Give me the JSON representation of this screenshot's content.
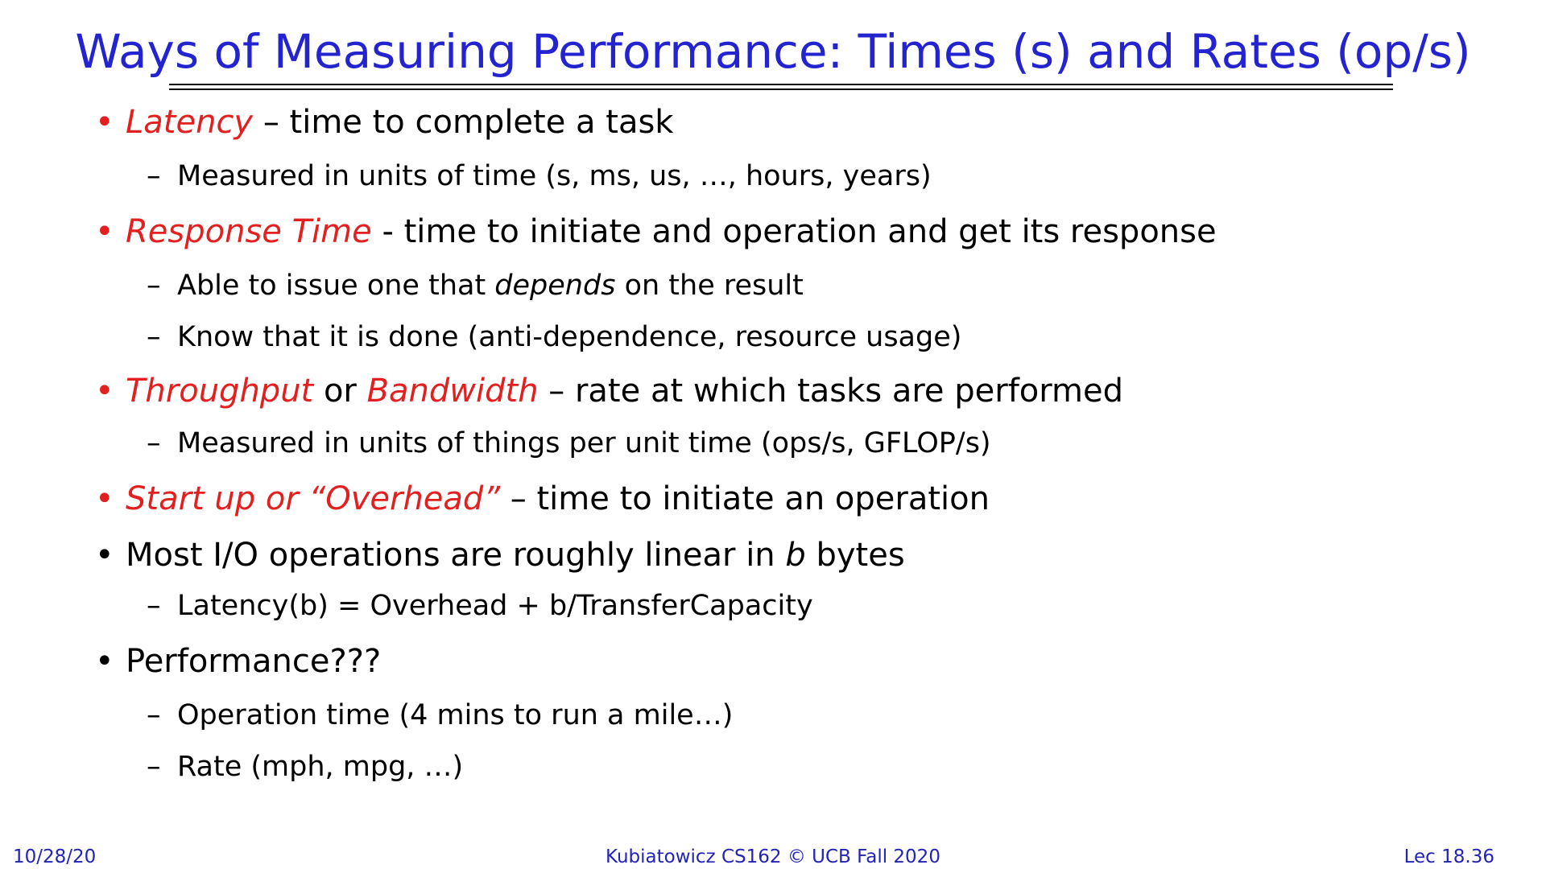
{
  "title": "Ways of Measuring Performance: Times (s) and Rates (op/s)",
  "bullets": [
    {
      "highlight": "Latency",
      "text": " – time to complete a task",
      "subs": [
        {
          "text": "Measured in units of time (s, ms, us, …, hours, years)"
        }
      ]
    },
    {
      "highlight": "Response Time",
      "text": " - time to initiate and operation and get its response",
      "subs": [
        {
          "pre": "Able to issue one that ",
          "em": "depends",
          "post": " on the result"
        },
        {
          "text": "Know that it is done (anti-dependence, resource usage)"
        }
      ]
    },
    {
      "highlight": "Throughput",
      "mid": " or ",
      "highlight2": "Bandwidth",
      "text": " – rate at which tasks are performed",
      "subs": [
        {
          "text": "Measured in units of things per unit time (ops/s, GFLOP/s)"
        }
      ]
    },
    {
      "highlight": "Start up or “Overhead”",
      "text": " – time to initiate an operation"
    },
    {
      "pre": "Most I/O operations are roughly linear in ",
      "em": "b",
      "post": " bytes",
      "subs": [
        {
          "text": "Latency(b) = Overhead + b/TransferCapacity"
        }
      ]
    },
    {
      "text": "Performance???",
      "subs": [
        {
          "text": "Operation time (4 mins to run a mile…)"
        },
        {
          "text": "Rate (mph, mpg, …)"
        }
      ]
    }
  ],
  "bullet_char": "•",
  "dash_char": "–",
  "footer": {
    "date": "10/28/20",
    "course": "Kubiatowicz CS162 © UCB Fall 2020",
    "lecture": "Lec 18.36"
  },
  "colors": {
    "title": "#2323d0",
    "highlight": "#e32020",
    "footer": "#2323b8",
    "text": "#000000"
  }
}
